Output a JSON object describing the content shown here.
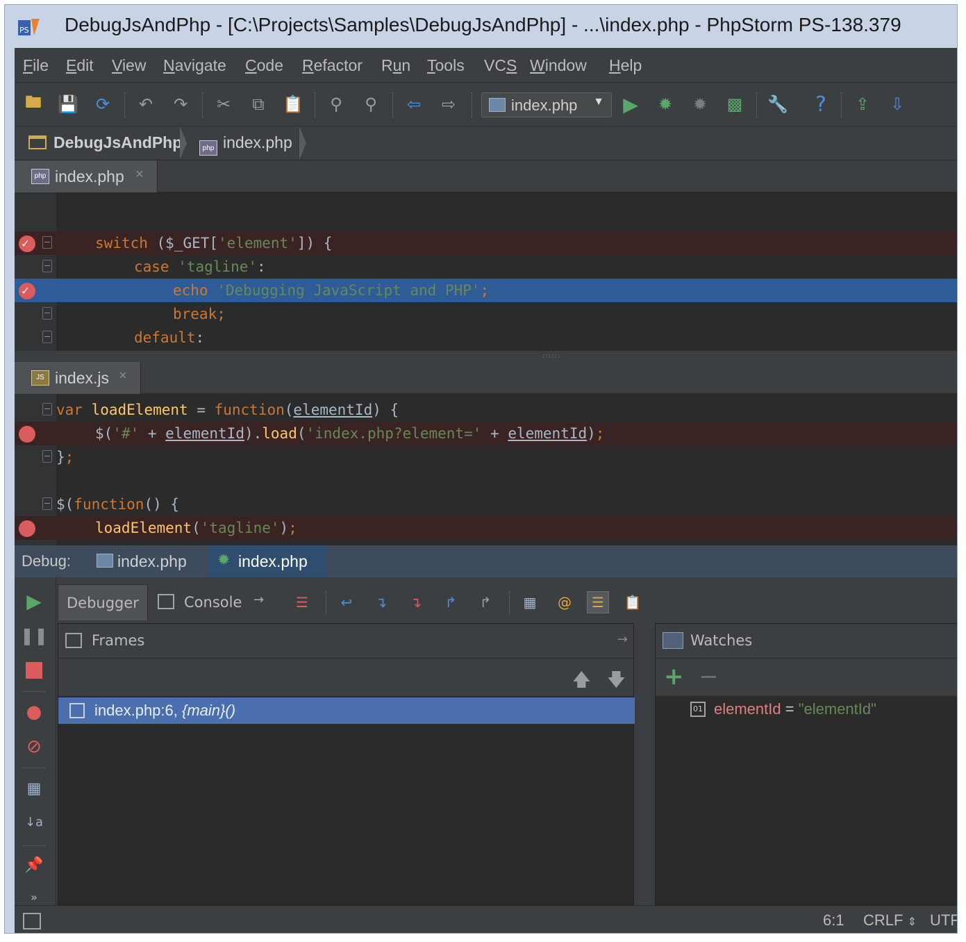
{
  "window": {
    "title": "DebugJsAndPhp - [C:\\Projects\\Samples\\DebugJsAndPhp] - ...\\index.php - PhpStorm PS-138.379"
  },
  "menu": [
    {
      "pre": "",
      "u": "F",
      "post": "ile"
    },
    {
      "pre": "",
      "u": "E",
      "post": "dit"
    },
    {
      "pre": "",
      "u": "V",
      "post": "iew"
    },
    {
      "pre": "",
      "u": "N",
      "post": "avigate"
    },
    {
      "pre": "",
      "u": "C",
      "post": "ode"
    },
    {
      "pre": "",
      "u": "R",
      "post": "efactor"
    },
    {
      "pre": "R",
      "u": "u",
      "post": "n"
    },
    {
      "pre": "",
      "u": "T",
      "post": "ools"
    },
    {
      "pre": "VC",
      "u": "S",
      "post": ""
    },
    {
      "pre": "",
      "u": "W",
      "post": "indow"
    },
    {
      "pre": "",
      "u": "H",
      "post": "elp"
    }
  ],
  "toolbar": {
    "run_config": "index.php",
    "icons": [
      "open-folder-icon",
      "save-icon",
      "sync-icon",
      "undo-icon",
      "redo-icon",
      "cut-icon",
      "copy-icon",
      "paste-icon",
      "find-icon",
      "replace-icon",
      "back-icon",
      "forward-icon",
      "run-icon",
      "debug-icon",
      "coverage-icon",
      "profile-icon",
      "settings-icon",
      "help-icon",
      "deploy-upload-icon",
      "deploy-download-icon"
    ]
  },
  "breadcrumb": {
    "project": "DebugJsAndPhp",
    "file": "index.php"
  },
  "editor_php": {
    "tab_label": "index.php",
    "close": "×",
    "lines": [
      {
        "parts": [
          [
            "kw",
            "switch"
          ],
          [
            "dim",
            " ("
          ],
          [
            "dim",
            "$_GET"
          ],
          [
            "dim",
            "["
          ],
          [
            "str",
            "'element'"
          ],
          [
            "dim",
            "]) {"
          ]
        ]
      },
      {
        "parts": [
          [
            "kw",
            "case"
          ],
          [
            "dim",
            " "
          ],
          [
            "str",
            "'tagline'"
          ],
          [
            "dim",
            ":"
          ]
        ]
      },
      {
        "parts": [
          [
            "kw",
            "echo"
          ],
          [
            "dim",
            " "
          ],
          [
            "str",
            "'Debugging JavaScript and PHP'"
          ],
          [
            "kw",
            ";"
          ]
        ]
      },
      {
        "parts": [
          [
            "kw",
            "break;"
          ]
        ]
      },
      {
        "parts": [
          [
            "kw",
            "default"
          ],
          [
            "dim",
            ":"
          ]
        ]
      }
    ]
  },
  "editor_js": {
    "tab_label": "index.js",
    "close": "×",
    "lines": [
      {
        "parts": [
          [
            "kw",
            "var"
          ],
          [
            "dim",
            " "
          ],
          [
            "fn",
            "loadElement"
          ],
          [
            "dim",
            " = "
          ],
          [
            "kw",
            "function"
          ],
          [
            "dim",
            "("
          ],
          [
            "ul",
            "elementId"
          ],
          [
            "dim",
            ") {"
          ]
        ]
      },
      {
        "parts": [
          [
            "dim",
            "$("
          ],
          [
            "str",
            "'#'"
          ],
          [
            "dim",
            " + "
          ],
          [
            "ul",
            "elementId"
          ],
          [
            "dim",
            ")."
          ],
          [
            "fn",
            "load"
          ],
          [
            "dim",
            "("
          ],
          [
            "str",
            "'index.php?element='"
          ],
          [
            "dim",
            " + "
          ],
          [
            "ul",
            "elementId"
          ],
          [
            "dim",
            ")"
          ],
          [
            "kw",
            ";"
          ]
        ]
      },
      {
        "parts": [
          [
            "dim",
            "}"
          ],
          [
            "kw",
            ";"
          ]
        ]
      },
      {
        "parts": [
          [
            "dim",
            ""
          ]
        ]
      },
      {
        "parts": [
          [
            "dim",
            "$("
          ],
          [
            "kw",
            "function"
          ],
          [
            "dim",
            "() {"
          ]
        ]
      },
      {
        "parts": [
          [
            "fn",
            "loadElement"
          ],
          [
            "dim",
            "("
          ],
          [
            "str",
            "'tagline'"
          ],
          [
            "dim",
            ")"
          ],
          [
            "kw",
            ";"
          ]
        ]
      }
    ]
  },
  "debug": {
    "label": "Debug:",
    "tabs": [
      "index.php",
      "index.php"
    ],
    "subtabs": {
      "debugger": "Debugger",
      "console": "Console"
    },
    "frames": {
      "title": "Frames",
      "row_main": "index.php:6, ",
      "row_func": "{main}()"
    },
    "watches": {
      "title": "Watches",
      "add": "+",
      "remove": "−",
      "name": "elementId",
      "eq": " = ",
      "value": "\"elementId\""
    }
  },
  "status": {
    "position": "6:1",
    "line_ending": "CRLF",
    "encoding": "UTF"
  },
  "colors": {
    "background": "#2b2b2b",
    "keyword": "#cc7832",
    "string": "#6a8759",
    "function": "#ffc66d",
    "breakpoint": "#db5c5c",
    "execution_line": "#2d5c97",
    "selection": "#4b6eaf"
  }
}
